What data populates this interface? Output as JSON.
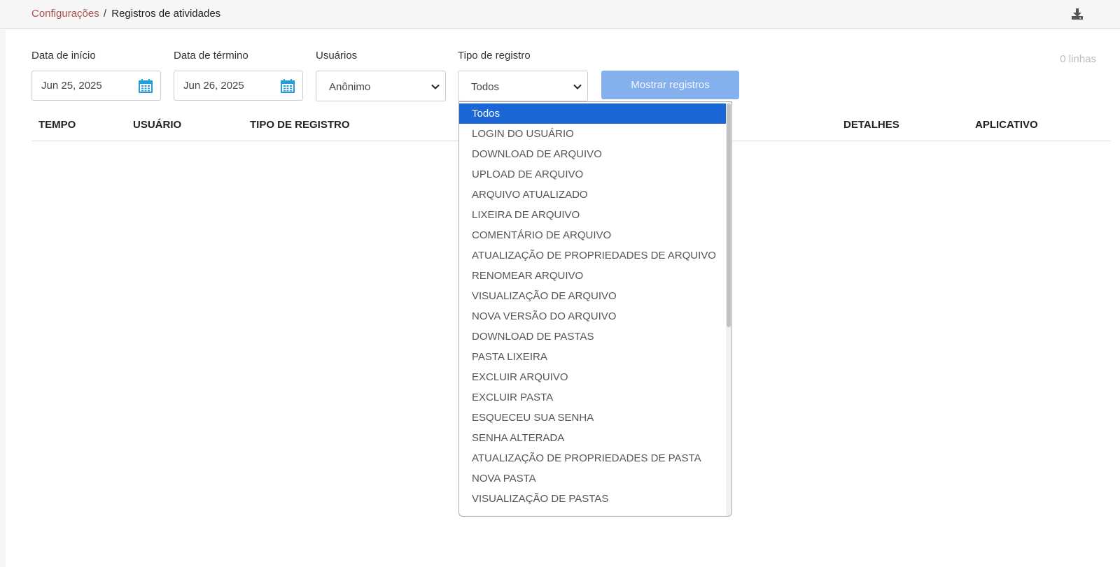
{
  "breadcrumb": {
    "parent": "Configurações",
    "separator": "/",
    "current": "Registros de atividades"
  },
  "filters": {
    "start_label": "Data de início",
    "start_value": "Jun 25, 2025",
    "end_label": "Data de término",
    "end_value": "Jun 26, 2025",
    "users_label": "Usuários",
    "users_value": "Anônimo",
    "type_label": "Tipo de registro",
    "type_value": "Todos",
    "show_button": "Mostrar registros",
    "row_count": "0 linhas"
  },
  "table": {
    "headers": [
      "TEMPO",
      "USUÁRIO",
      "TIPO DE REGISTRO",
      "DETALHES",
      "APLICATIVO"
    ]
  },
  "dropdown": {
    "options": [
      "Todos",
      "LOGIN DO USUÁRIO",
      "DOWNLOAD DE ARQUIVO",
      "UPLOAD DE ARQUIVO",
      "ARQUIVO ATUALIZADO",
      "LIXEIRA DE ARQUIVO",
      "COMENTÁRIO DE ARQUIVO",
      "ATUALIZAÇÃO DE PROPRIEDADES DE ARQUIVO",
      "RENOMEAR ARQUIVO",
      "VISUALIZAÇÃO DE ARQUIVO",
      "NOVA VERSÃO DO ARQUIVO",
      "DOWNLOAD DE PASTAS",
      "PASTA LIXEIRA",
      "EXCLUIR ARQUIVO",
      "EXCLUIR PASTA",
      "ESQUECEU SUA SENHA",
      "SENHA ALTERADA",
      "ATUALIZAÇÃO DE PROPRIEDADES DE PASTA",
      "NOVA PASTA",
      "VISUALIZAÇÃO DE PASTAS"
    ],
    "selected_index": 0
  },
  "colors": {
    "breadcrumb_link": "#a5534a",
    "show_button_bg": "#84b0ee",
    "selected_option_bg": "#1a66d6",
    "calendar_icon": "#1e9fd9"
  },
  "icons": {
    "download": "download-icon",
    "calendar": "calendar-icon",
    "chevron": "chevron-down-icon"
  }
}
